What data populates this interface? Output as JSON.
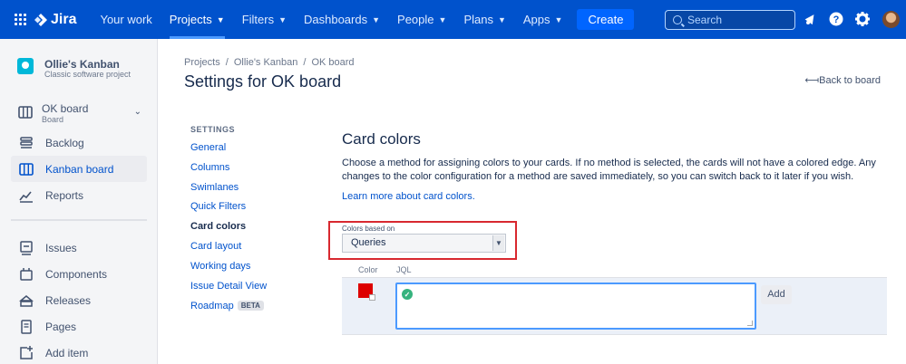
{
  "topnav": {
    "product": "Jira",
    "items": [
      {
        "label": "Your work",
        "dropdown": false
      },
      {
        "label": "Projects",
        "dropdown": true,
        "active": true
      },
      {
        "label": "Filters",
        "dropdown": true
      },
      {
        "label": "Dashboards",
        "dropdown": true
      },
      {
        "label": "People",
        "dropdown": true
      },
      {
        "label": "Plans",
        "dropdown": true
      },
      {
        "label": "Apps",
        "dropdown": true
      }
    ],
    "create_label": "Create",
    "search_placeholder": "Search",
    "colors": {
      "bar": "#0052cc",
      "create": "#0065ff"
    }
  },
  "sidebar": {
    "project_name": "Ollie's Kanban",
    "project_type": "Classic software project",
    "board_name": "OK board",
    "board_type": "Board",
    "items": [
      {
        "label": "Backlog",
        "icon": "backlog-icon"
      },
      {
        "label": "Kanban board",
        "icon": "board-icon",
        "active": true
      },
      {
        "label": "Reports",
        "icon": "reports-icon"
      },
      {
        "label": "Issues",
        "icon": "issues-icon"
      },
      {
        "label": "Components",
        "icon": "components-icon"
      },
      {
        "label": "Releases",
        "icon": "releases-icon"
      },
      {
        "label": "Pages",
        "icon": "pages-icon"
      },
      {
        "label": "Add item",
        "icon": "add-item-icon"
      }
    ]
  },
  "breadcrumb": [
    "Projects",
    "Ollie's Kanban",
    "OK board"
  ],
  "page_title": "Settings for OK board",
  "back_link": "Back to board",
  "settings_nav": {
    "heading": "SETTINGS",
    "items": [
      {
        "label": "General"
      },
      {
        "label": "Columns"
      },
      {
        "label": "Swimlanes"
      },
      {
        "label": "Quick Filters"
      },
      {
        "label": "Card colors",
        "active": true
      },
      {
        "label": "Card layout"
      },
      {
        "label": "Working days"
      },
      {
        "label": "Issue Detail View"
      },
      {
        "label": "Roadmap",
        "badge": "BETA"
      }
    ]
  },
  "card_colors": {
    "title": "Card colors",
    "description": "Choose a method for assigning colors to your cards. If no method is selected, the cards will not have a colored edge. Any changes to the color configuration for a method are saved immediately, so you can switch back to it later if you wish.",
    "learn_more": "Learn more about card colors.",
    "select_label": "Colors based on",
    "select_value": "Queries",
    "table_headers": {
      "color": "Color",
      "jql": "JQL"
    },
    "row": {
      "swatch_color": "#dd0000",
      "jql_value": ""
    },
    "add_label": "Add"
  }
}
